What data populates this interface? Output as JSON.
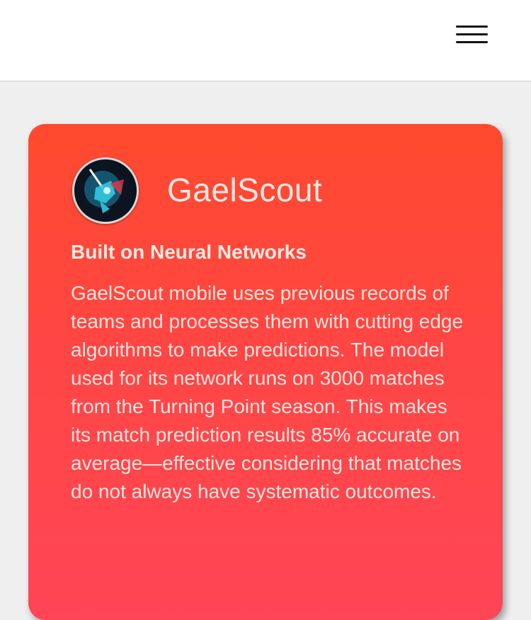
{
  "header": {
    "menu_icon": "hamburger-menu-icon"
  },
  "card": {
    "logo_icon": "gaelscout-logo",
    "app_name": "GaelScout",
    "headline": "Built on Neural Networks",
    "body": "GaelScout mobile uses previous records of teams and processes them with cutting edge algorithms to make predictions. The model used for its network runs on 3000 matches from the Turning Point season. This makes its match prediction results 85% accurate on average—effective considering that matches do not always have systematic outcomes.",
    "colors": {
      "gradient_top": "#ff4a2e",
      "gradient_bottom": "#ff4556",
      "text": "#fce4de"
    }
  }
}
